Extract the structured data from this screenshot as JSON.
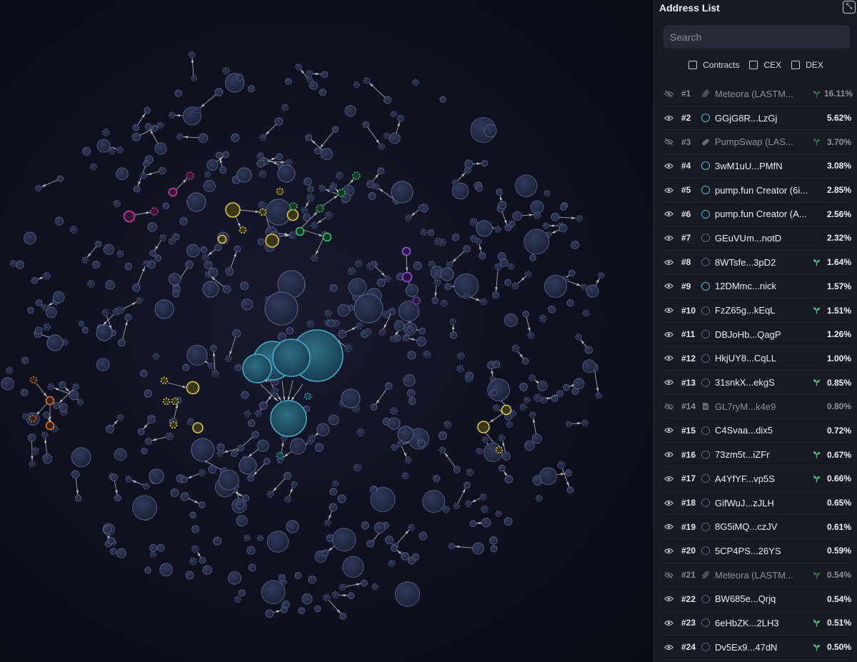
{
  "panel": {
    "title": "Address List",
    "search_placeholder": "Search",
    "filters": [
      {
        "label": "Contracts",
        "checked": false
      },
      {
        "label": "CEX",
        "checked": false
      },
      {
        "label": "DEX",
        "checked": false
      }
    ]
  },
  "rows": [
    {
      "rank": "#1",
      "name": "Meteora (LASTM...",
      "pct": "16.11%",
      "hidden": true,
      "icon": "stripe-icon",
      "sprout": true
    },
    {
      "rank": "#2",
      "name": "GGjG8R...LzGj",
      "pct": "5.62%",
      "hidden": false,
      "icon": "ring-cyan",
      "sprout": false
    },
    {
      "rank": "#3",
      "name": "PumpSwap (LAS...",
      "pct": "3.70%",
      "hidden": true,
      "icon": "pill-icon",
      "sprout": true
    },
    {
      "rank": "#4",
      "name": "3wM1uU...PMfN",
      "pct": "3.08%",
      "hidden": false,
      "icon": "ring-cyan",
      "sprout": false
    },
    {
      "rank": "#5",
      "name": "pump.fun Creator (6i...",
      "pct": "2.85%",
      "hidden": false,
      "icon": "ring-cyan",
      "sprout": false
    },
    {
      "rank": "#6",
      "name": "pump.fun Creator (A...",
      "pct": "2.56%",
      "hidden": false,
      "icon": "ring-cyan",
      "sprout": false
    },
    {
      "rank": "#7",
      "name": "GEuVUm...notD",
      "pct": "2.32%",
      "hidden": false,
      "icon": "ring",
      "sprout": false
    },
    {
      "rank": "#8",
      "name": "8WTsfe...3pD2",
      "pct": "1.64%",
      "hidden": false,
      "icon": "ring",
      "sprout": true
    },
    {
      "rank": "#9",
      "name": "12DMmc...nick",
      "pct": "1.57%",
      "hidden": false,
      "icon": "ring-cyan",
      "sprout": false
    },
    {
      "rank": "#10",
      "name": "FzZ65g...kEqL",
      "pct": "1.51%",
      "hidden": false,
      "icon": "ring",
      "sprout": true
    },
    {
      "rank": "#11",
      "name": "DBJoHb...QagP",
      "pct": "1.26%",
      "hidden": false,
      "icon": "ring",
      "sprout": false
    },
    {
      "rank": "#12",
      "name": "HkjUY8...CqLL",
      "pct": "1.00%",
      "hidden": false,
      "icon": "ring",
      "sprout": false
    },
    {
      "rank": "#13",
      "name": "31snkX...ekgS",
      "pct": "0.85%",
      "hidden": false,
      "icon": "ring",
      "sprout": true
    },
    {
      "rank": "#14",
      "name": "GL7ryM...k4e9",
      "pct": "0.80%",
      "hidden": true,
      "icon": "doc-icon",
      "sprout": false
    },
    {
      "rank": "#15",
      "name": "C4Svaa...dix5",
      "pct": "0.72%",
      "hidden": false,
      "icon": "ring",
      "sprout": false
    },
    {
      "rank": "#16",
      "name": "73zm5t...iZFr",
      "pct": "0.67%",
      "hidden": false,
      "icon": "ring",
      "sprout": true
    },
    {
      "rank": "#17",
      "name": "A4YfYF...vp5S",
      "pct": "0.66%",
      "hidden": false,
      "icon": "ring",
      "sprout": true
    },
    {
      "rank": "#18",
      "name": "GifWuJ...zJLH",
      "pct": "0.65%",
      "hidden": false,
      "icon": "ring",
      "sprout": false
    },
    {
      "rank": "#19",
      "name": "8G5iMQ...czJV",
      "pct": "0.61%",
      "hidden": false,
      "icon": "ring",
      "sprout": false
    },
    {
      "rank": "#20",
      "name": "5CP4PS...26YS",
      "pct": "0.59%",
      "hidden": false,
      "icon": "ring",
      "sprout": false
    },
    {
      "rank": "#21",
      "name": "Meteora (LASTM...",
      "pct": "0.54%",
      "hidden": true,
      "icon": "stripe-icon",
      "sprout": true
    },
    {
      "rank": "#22",
      "name": "BW685e...Qrjq",
      "pct": "0.54%",
      "hidden": false,
      "icon": "ring",
      "sprout": false
    },
    {
      "rank": "#23",
      "name": "6eHbZK...2LH3",
      "pct": "0.51%",
      "hidden": false,
      "icon": "ring",
      "sprout": true
    },
    {
      "rank": "#24",
      "name": "Dv5Ex9...47dN",
      "pct": "0.50%",
      "hidden": false,
      "icon": "ring",
      "sprout": true
    }
  ],
  "colors": {
    "node": "#2a3350",
    "node_stroke": "#5f6a92",
    "cyan": "#4fb8d6",
    "yellow": "#e8cf4a",
    "green": "#46d07a",
    "magenta": "#e040b0",
    "purple": "#a855f7",
    "orange": "#e8823a",
    "sprout": "#4cc07a"
  }
}
